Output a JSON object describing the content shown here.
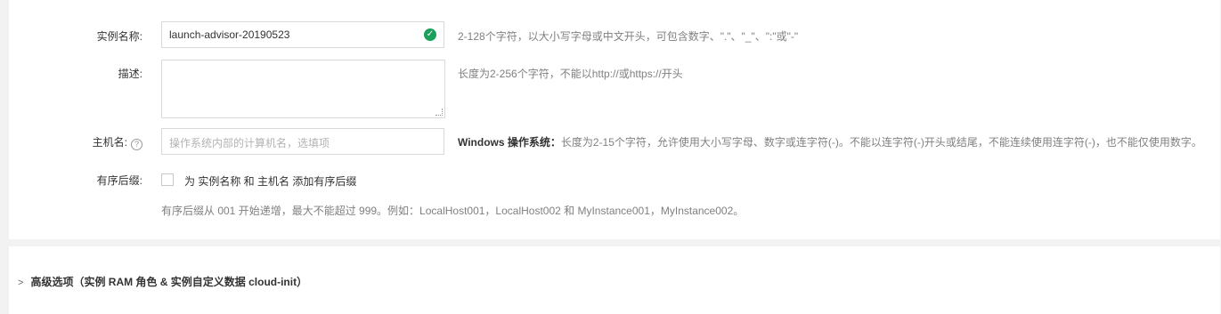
{
  "form": {
    "instance_name": {
      "label": "实例名称:",
      "value": "launch-advisor-20190523",
      "hint": "2-128个字符，以大小写字母或中文开头，可包含数字、\".\"、\"_\"、\":\"或\"-\""
    },
    "description": {
      "label": "描述:",
      "hint": "长度为2-256个字符，不能以http://或https://开头"
    },
    "hostname": {
      "label": "主机名:",
      "placeholder": "操作系统内部的计算机名，选填项",
      "hint_bold": "Windows 操作系统：",
      "hint": "长度为2-15个字符，允许使用大小写字母、数字或连字符(-)。不能以连字符(-)开头或结尾，不能连续使用连字符(-)，也不能仅使用数字。"
    },
    "ordered_suffix": {
      "label": "有序后缀:",
      "checkbox_text": "为 实例名称 和 主机名 添加有序后缀",
      "checked": false,
      "note": "有序后缀从 001 开始递增，最大不能超过 999。例如：LocalHost001，LocalHost002 和 MyInstance001，MyInstance002。"
    }
  },
  "advanced": {
    "label": "高级选项（实例 RAM 角色 & 实例自定义数据 cloud-init）"
  },
  "icons": {
    "valid": "check-circle-icon",
    "help": "question-circle-icon",
    "expand": "chevron-right-icon"
  },
  "colors": {
    "valid_green": "#1aa05a",
    "hint_gray": "#808080"
  }
}
